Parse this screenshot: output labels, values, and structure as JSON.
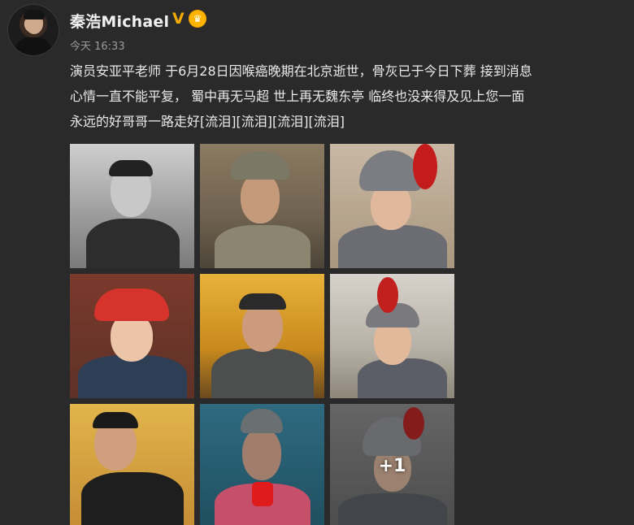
{
  "user": {
    "name": "秦浩Michael",
    "verified_mark": "V",
    "badge_icon": "crown-icon"
  },
  "post": {
    "timestamp": "今天 16:33",
    "text_lines": [
      "演员安亚平老师 于6月28日因喉癌晚期在北京逝世，骨灰已于今日下葬 接到消息",
      "心情一直不能平复， 蜀中再无马超 世上再无魏东亭 临终也没来得及见上您一面",
      "永远的好哥哥一路走好[流泪][流泪][流泪][流泪]"
    ]
  },
  "gallery": {
    "more_count_label": "+1",
    "photos": [
      {
        "name": "photo-1",
        "desc": "black-and-white portrait smiling"
      },
      {
        "name": "photo-2",
        "desc": "soldier with cap"
      },
      {
        "name": "photo-3",
        "desc": "warrior with helmet and red plume"
      },
      {
        "name": "photo-4",
        "desc": "qing official with red hat"
      },
      {
        "name": "photo-5",
        "desc": "armored general in palace"
      },
      {
        "name": "photo-6",
        "desc": "warrior with red plume outdoors"
      },
      {
        "name": "photo-7",
        "desc": "smiling man leaning"
      },
      {
        "name": "photo-8",
        "desc": "ornate costumed figure"
      },
      {
        "name": "photo-9",
        "desc": "helmeted warrior, more overlay"
      }
    ]
  },
  "colors": {
    "background": "#2a2a2a",
    "verified": "#f2a900",
    "text": "#eaeaea",
    "muted": "#9a9a9a"
  }
}
